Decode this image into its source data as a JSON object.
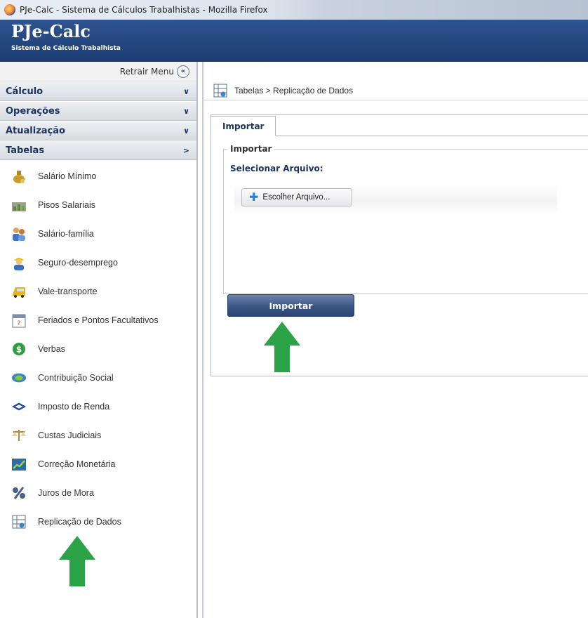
{
  "window": {
    "title": "PJe-Calc - Sistema de Cálculos Trabalhistas - Mozilla Firefox"
  },
  "app": {
    "logo": "PJe-Calc",
    "subtitle": "Sistema de Cálculo Trabalhista"
  },
  "sidebar": {
    "collapse_label": "Retrair Menu",
    "collapse_icon": "«",
    "sections": [
      {
        "label": "Cálculo",
        "chevron": "∨"
      },
      {
        "label": "Operações",
        "chevron": "∨"
      },
      {
        "label": "Atualização",
        "chevron": "∨"
      },
      {
        "label": "Tabelas",
        "chevron": ">"
      }
    ],
    "items": [
      {
        "label": "Salário Mínimo",
        "icon": "money-bag-icon"
      },
      {
        "label": "Pisos Salariais",
        "icon": "chart-cash-icon"
      },
      {
        "label": "Salário-família",
        "icon": "family-icon"
      },
      {
        "label": "Seguro-desemprego",
        "icon": "worker-icon"
      },
      {
        "label": "Vale-transporte",
        "icon": "bus-icon"
      },
      {
        "label": "Feriados e Pontos Facultativos",
        "icon": "calendar-icon"
      },
      {
        "label": "Verbas",
        "icon": "dollar-coin-icon"
      },
      {
        "label": "Contribuição Social",
        "icon": "social-security-icon"
      },
      {
        "label": "Imposto de Renda",
        "icon": "tax-icon"
      },
      {
        "label": "Custas Judiciais",
        "icon": "scales-icon"
      },
      {
        "label": "Correção Monetária",
        "icon": "growth-chart-icon"
      },
      {
        "label": "Juros de Mora",
        "icon": "percent-icon"
      },
      {
        "label": "Replicação de Dados",
        "icon": "table-data-icon"
      }
    ]
  },
  "main": {
    "breadcrumb": "Tabelas > Replicação de Dados",
    "tab_label": "Importar",
    "fieldset_legend": "Importar",
    "select_file_label": "Selecionar Arquivo:",
    "choose_file_button": "Escolher Arquivo...",
    "import_button": "Importar"
  },
  "colors": {
    "header_blue": "#1c3c72",
    "arrow_green": "#2aa245",
    "accent_text": "#1c3560"
  }
}
